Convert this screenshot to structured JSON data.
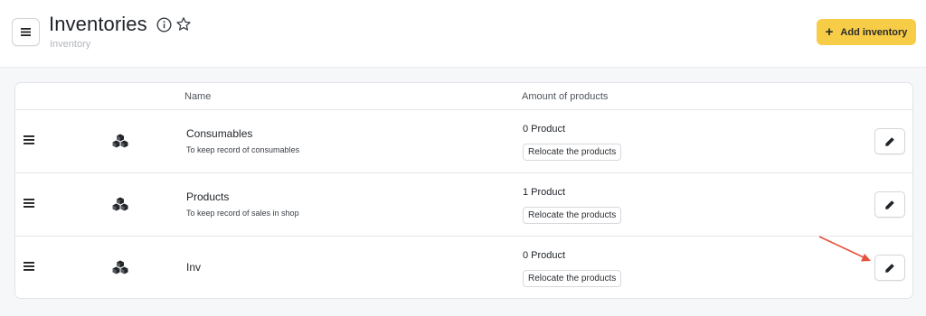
{
  "header": {
    "title": "Inventories",
    "breadcrumb": "Inventory",
    "add_button_label": "Add inventory",
    "add_button_icon": "plus-icon",
    "menu_icon": "hamburger-icon",
    "info_icon": "info-icon",
    "favorite_icon": "star-icon"
  },
  "table": {
    "columns": [
      "Name",
      "Amount of products"
    ],
    "rows": [
      {
        "name": "Consumables",
        "description": "To keep record of consumables",
        "amount": "0 Product",
        "relocate_label": "Relocate the products"
      },
      {
        "name": "Products",
        "description": "To keep record of sales in shop",
        "amount": "1 Product",
        "relocate_label": "Relocate the products"
      },
      {
        "name": "Inv",
        "description": "",
        "amount": "0 Product",
        "relocate_label": "Relocate the products"
      }
    ]
  },
  "colors": {
    "accent": "#f7cc47",
    "annotation_arrow": "#e5533d"
  }
}
